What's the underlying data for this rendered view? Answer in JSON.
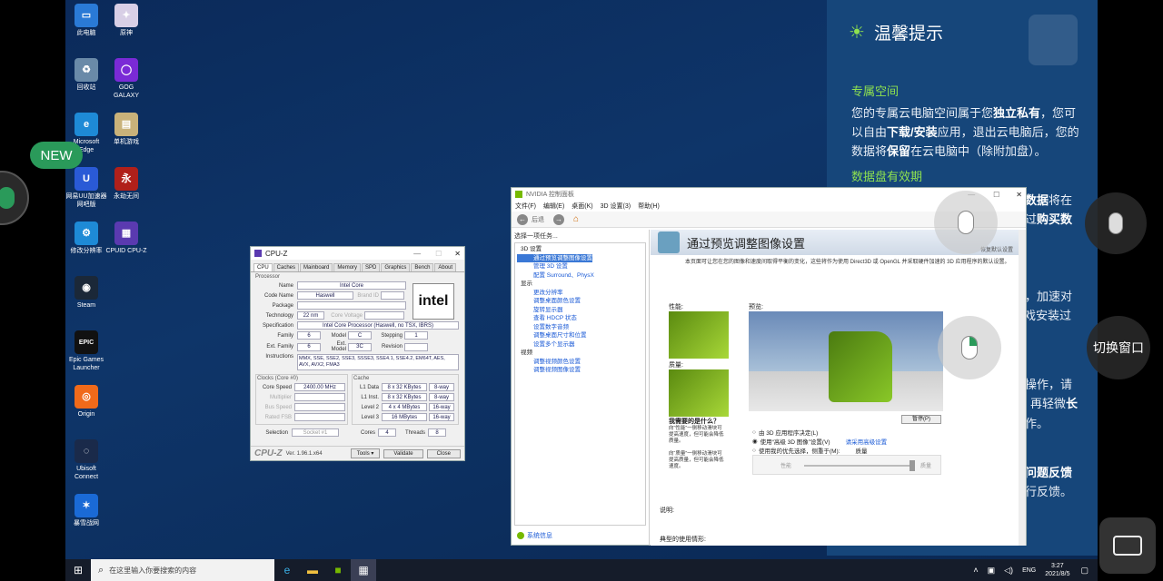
{
  "desktop_icons": [
    {
      "label": "此电脑",
      "color": "#2a7ad6",
      "glyph": "▭"
    },
    {
      "label": "原神",
      "color": "#d8cfe6",
      "glyph": "✦"
    },
    {
      "label": "回收站",
      "color": "#6a8aa8",
      "glyph": "♻"
    },
    {
      "label": "GOG GALAXY",
      "color": "#7a2ad6",
      "glyph": "◯"
    },
    {
      "label": "Microsoft Edge",
      "color": "#1e8ad6",
      "glyph": "e"
    },
    {
      "label": "单机游戏",
      "color": "#c9b27a",
      "glyph": "▤"
    },
    {
      "label": "网易UU加速器网吧版",
      "color": "#2a5ad6",
      "glyph": "U"
    },
    {
      "label": "永劫无间",
      "color": "#b0201a",
      "glyph": "永"
    },
    {
      "label": "修改分辨率",
      "color": "#1e8ad6",
      "glyph": "⚙"
    },
    {
      "label": "CPUID CPU-Z",
      "color": "#5a3ab0",
      "glyph": "▦"
    },
    {
      "label": "Steam",
      "color": "#1b2838",
      "glyph": "◉"
    },
    {
      "label": "Epic Games Launcher",
      "color": "#111",
      "glyph": "EPIC"
    },
    {
      "label": "Origin",
      "color": "#f06a1a",
      "glyph": "◎"
    },
    {
      "label": "Ubisoft Connect",
      "color": "#1a2a4a",
      "glyph": "◌"
    },
    {
      "label": "暴雪战网",
      "color": "#1a6ad6",
      "glyph": "✶"
    }
  ],
  "new_badge": "NEW",
  "tips": {
    "title": "温馨提示",
    "s1_title": "专属空间",
    "s1_text_a": "您的专属云电脑空间属于您",
    "s1_bold_a": "独立私有",
    "s1_text_b": "，您可以自由",
    "s1_bold_b": "下载/安装",
    "s1_text_c": "应用，退出云电脑后，您的数据将",
    "s1_bold_c": "保留",
    "s1_text_d": "在云电脑中（除附加盘）。",
    "s2_title": "数据盘有效期",
    "frag1": "数据",
    "frag1b": "将在",
    "frag2": "过",
    "frag2b": "购买数",
    "frag3": "，加速对",
    "frag4": "游戏安装过",
    "frag5": "操作，请",
    "frag6": "再轻微",
    "frag6b": "长",
    "frag7": "作。",
    "frag8": "问题反馈",
    "frag9": "行反馈。"
  },
  "switch_window": "切换窗口",
  "cpuz": {
    "title": "CPU-Z",
    "tabs": [
      "CPU",
      "Caches",
      "Mainboard",
      "Memory",
      "SPD",
      "Graphics",
      "Bench",
      "About"
    ],
    "processor_label": "Processor",
    "name_label": "Name",
    "name": "Intel Core",
    "codename_label": "Code Name",
    "codename": "Haswell",
    "brandid_label": "Brand ID",
    "package_label": "Package",
    "tech_label": "Technology",
    "tech": "22 nm",
    "corevolt_label": "Core Voltage",
    "spec_label": "Specification",
    "spec": "Intel Core Processor (Haswell, no TSX, IBRS)",
    "family_label": "Family",
    "family": "6",
    "model_label": "Model",
    "model": "C",
    "stepping_label": "Stepping",
    "stepping": "1",
    "extfamily_label": "Ext. Family",
    "extfamily": "6",
    "extmodel_label": "Ext. Model",
    "extmodel": "3C",
    "revision_label": "Revision",
    "instr_label": "Instructions",
    "instr": "MMX, SSE, SSE2, SSE3, SSSE3, SSE4.1, SSE4.2, EM64T, AES, AVX, AVX2, FMA3",
    "clocks_label": "Clocks (Core #0)",
    "corespeed_label": "Core Speed",
    "corespeed": "2400.00 MHz",
    "multiplier_label": "Multiplier",
    "busspeed_label": "Bus Speed",
    "ratedfsb_label": "Rated FSB",
    "cache_label": "Cache",
    "l1d_label": "L1 Data",
    "l1d": "8 x 32 KBytes",
    "l1d_way": "8-way",
    "l1i_label": "L1 Inst.",
    "l1i": "8 x 32 KBytes",
    "l1i_way": "8-way",
    "l2_label": "Level 2",
    "l2": "4 x 4 MBytes",
    "l2_way": "16-way",
    "l3_label": "Level 3",
    "l3": "16 MBytes",
    "l3_way": "16-way",
    "selection_label": "Selection",
    "selection": "Socket #1",
    "cores_label": "Cores",
    "cores": "4",
    "threads_label": "Threads",
    "threads": "8",
    "brand": "CPU-Z",
    "version": "Ver. 1.96.1.x64",
    "tools": "Tools",
    "validate": "Validate",
    "close": "Close",
    "logo": "intel"
  },
  "nvidia": {
    "title": "NVIDIA 控制面板",
    "menu": [
      "文件(F)",
      "编辑(E)",
      "桌面(K)",
      "3D 设置(3)",
      "帮助(H)"
    ],
    "back": "后退",
    "task_label": "选择一项任务...",
    "tree": [
      {
        "text": "3D 设置",
        "lvl": 0
      },
      {
        "text": "通过预览调整图像设置",
        "lvl": 1,
        "sel": true
      },
      {
        "text": "管理 3D 设置",
        "lvl": 1
      },
      {
        "text": "配置 Surround、PhysX",
        "lvl": 1
      },
      {
        "text": "显示",
        "lvl": 0
      },
      {
        "text": "更改分辨率",
        "lvl": 1
      },
      {
        "text": "调整桌面颜色设置",
        "lvl": 1
      },
      {
        "text": "旋转显示器",
        "lvl": 1
      },
      {
        "text": "查看 HDCP 状态",
        "lvl": 1
      },
      {
        "text": "设置数字音频",
        "lvl": 1
      },
      {
        "text": "调整桌面尺寸和位置",
        "lvl": 1
      },
      {
        "text": "设置多个显示器",
        "lvl": 1
      },
      {
        "text": "视频",
        "lvl": 0
      },
      {
        "text": "调整视频颜色设置",
        "lvl": 1
      },
      {
        "text": "调整视频图像设置",
        "lvl": 1
      }
    ],
    "sysinfo": "系统信息",
    "heading": "通过预览调整图像设置",
    "restore": "恢复默认设置",
    "desc": "本页面可让您在您的图像和速度间取得平衡的变化，这些将作为使用 Direct3D 或 OpenGL 并采取硬件加速的 3D 应用程序的默认设置。",
    "perf_label": "性能:",
    "quality_label": "质量:",
    "preview_label": "预览:",
    "pause": "暂停(P)",
    "q1": "我需要的是什么？",
    "q1_text": "向“性能”一侧移动滑块可提高速度，但可能会降低质量。",
    "q2_text": "向“质量”一侧移动滑块可提高质量，但可能会降低速度。",
    "radio1": "由 3D 应用程序决定(L)",
    "radio2": "使用“高级 3D 图像”设置(V)",
    "radio2_link": "请采用高级设置",
    "radio3": "使用我的优先选择，侧重于(M):",
    "radio3_val": "质量",
    "slider_left": "性能",
    "slider_right": "质量",
    "desc_label": "说明:",
    "usage_label": "典型的使用情形:"
  },
  "taskbar": {
    "search_placeholder": "在这里输入你要搜索的内容",
    "lang": "ENG",
    "time": "3:27",
    "date": "2021/8/5"
  }
}
